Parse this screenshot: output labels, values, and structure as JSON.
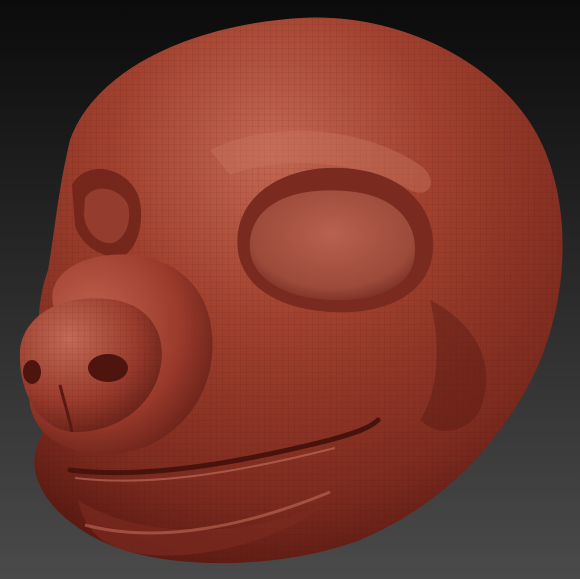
{
  "viewport": {
    "background_top": "#0b0b0b",
    "background_bottom": "#4a4a4a"
  },
  "model": {
    "subject": "sculpted-animal-head-mask",
    "material_base": "#9a3a2c",
    "material_highlight": "#c76a55",
    "material_shadow": "#4a120c",
    "wireframe_visible": true
  }
}
